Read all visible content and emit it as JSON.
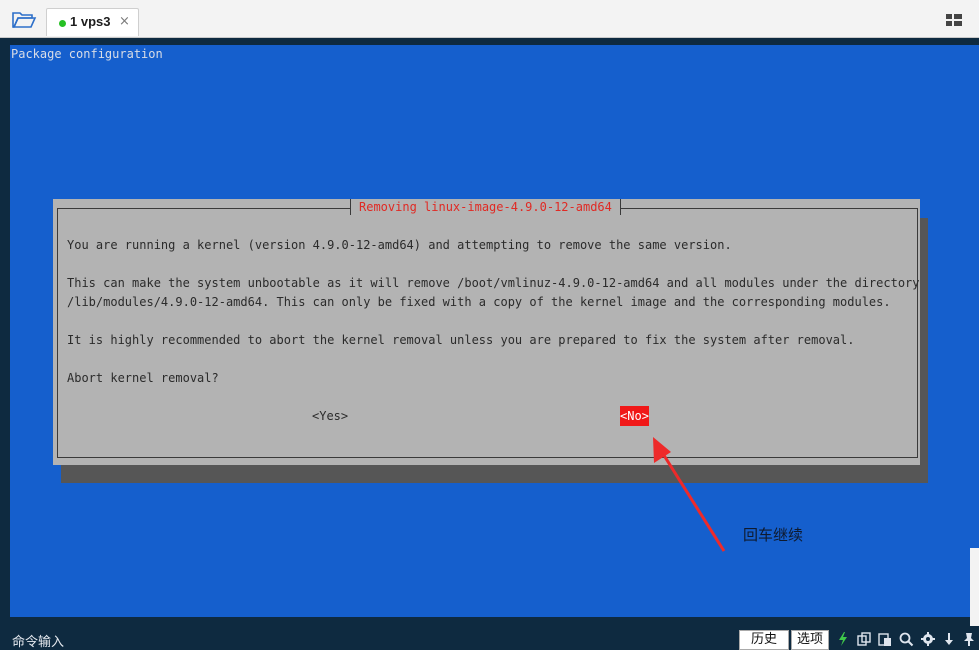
{
  "tab": {
    "label": "1 vps3",
    "close": "×",
    "status_color": "#26c024"
  },
  "terminal": {
    "title": "Package configuration",
    "background": "#155fcd",
    "dialog": {
      "title": "Removing linux-image-4.9.0-12-amd64",
      "lines": [
        "You are running a kernel (version 4.9.0-12-amd64) and attempting to remove the same version.",
        "This can make the system unbootable as it will remove /boot/vmlinuz-4.9.0-12-amd64 and all modules under the directory",
        "/lib/modules/4.9.0-12-amd64. This can only be fixed with a copy of the kernel image and the corresponding modules.",
        "It is highly recommended to abort the kernel removal unless you are prepared to fix the system after removal.",
        "Abort kernel removal?"
      ],
      "yes_label": "<Yes>",
      "no_label": "<No>",
      "selected": "<No>",
      "accent_color": "#e02a24"
    }
  },
  "annotation": {
    "text": "回车继续",
    "arrow_color": "#ee2a2a"
  },
  "bottombar": {
    "command_label": "命令输入",
    "history_label": "历史",
    "options_label": "选项",
    "icons": [
      "lightning-icon",
      "copy-icon",
      "paste-icon",
      "search-icon",
      "gear-icon",
      "download-icon",
      "pin-icon"
    ]
  }
}
